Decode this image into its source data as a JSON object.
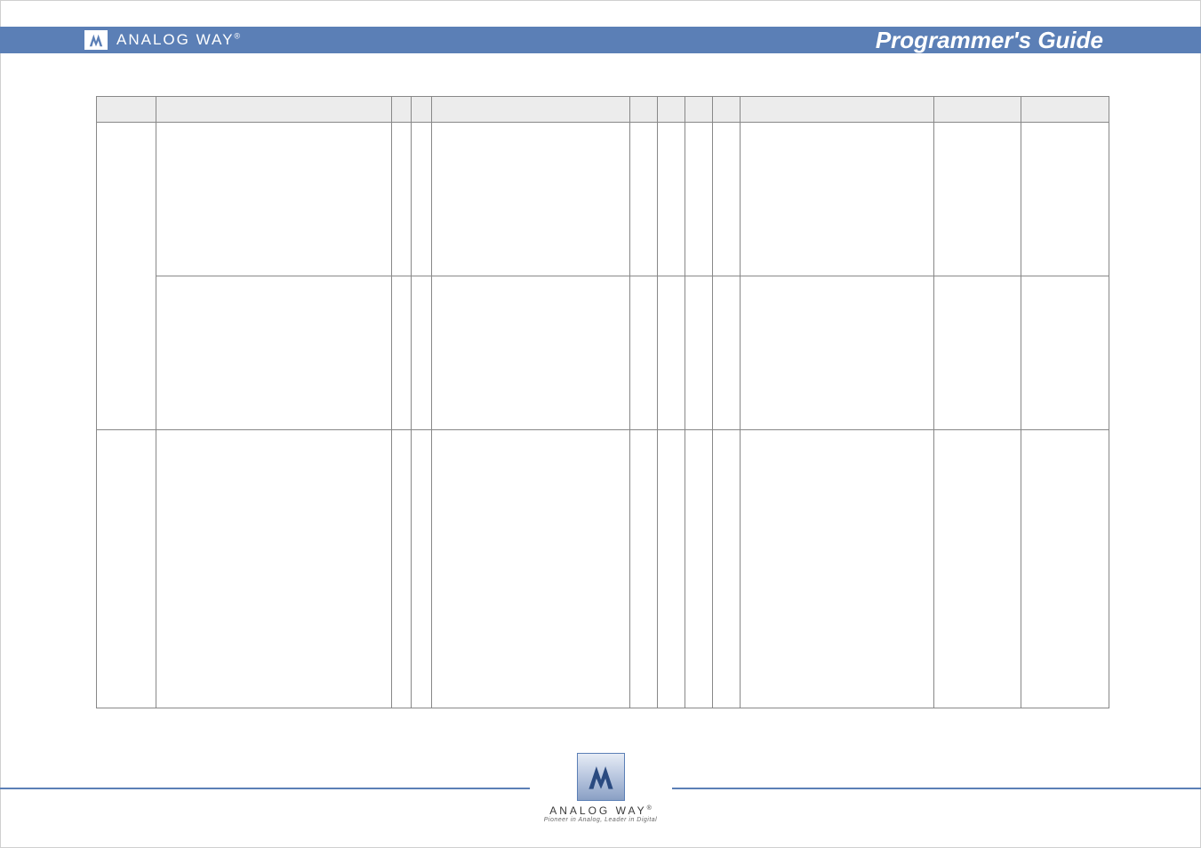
{
  "banner": {
    "brand": "ANALOG WAY",
    "reg": "®",
    "title": "Programmer's Guide"
  },
  "footer": {
    "brand": "ANALOG WAY",
    "reg": "®",
    "tag": "Pioneer in Analog, Leader in Digital"
  }
}
